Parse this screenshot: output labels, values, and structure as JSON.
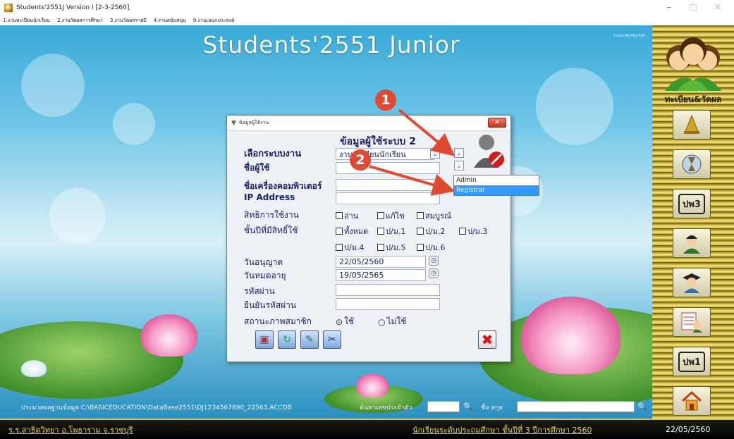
{
  "window": {
    "title": "Students'2551J Version I [2-3-2560]",
    "controls": {
      "minimize": "–",
      "maximize": "□",
      "close": "✕"
    }
  },
  "menu": {
    "items": [
      "1.งานทะเบียนนักเรียน",
      "2.งานวัดผลการศึกษา",
      "3.งานวัดผลรายปี",
      "4.งานสนับสนุน",
      "9.งานเอนกประสงค์"
    ]
  },
  "desktop": {
    "app_title": "Students'2551 Junior",
    "version_tag": "Comp.05/05/2560",
    "status_path": "ประมวลผลฐานข้อมูล C:\\BASICEDUCATION\\DataBase2551\\DJ1234567890_22563.ACCDB",
    "search_id_label": "ค้นหาเลขประจำตัว",
    "search_id_value": "",
    "search_name_label": "ชื่อ  สกุล",
    "search_name_value": ""
  },
  "bottombar": {
    "school": "ร.ร.สาธิตวิทยา  อ.โพธาราม  จ.ราชบุรี",
    "level": "นักเรียนระดับประถมศึกษา  ชั้นปีที่ 3  ปีการศึกษา 2560",
    "date": "22/05/2560"
  },
  "rightpanel": {
    "label": "ทะเบียน&วัดผล",
    "buttons": [
      "bell-icon",
      "hourglass-icon",
      "pw3-icon",
      "student-icon",
      "graduate-icon",
      "grade-sheet-icon",
      "pw1-icon",
      "home-icon"
    ],
    "pw3_text": "ปพ3",
    "pw1_text": "ปพ1"
  },
  "dialog": {
    "title": "ข้อมูลผู้ใช้งาน",
    "heading": "ข้อมูลผู้ใช้ระบบ 2",
    "labels": {
      "work_system": "เลือกระบบงาน",
      "user_name": "ชื่อผู้ใช้",
      "computer_name": "ชื่อเครื่องคอมพิวเตอร์",
      "ip_address": "IP Address",
      "rights": "สิทธิการใช้งาน",
      "grades": "ชั้นปีที่มีสิทธิ์ใช้",
      "permit_date": "วันอนุญาต",
      "expire_date": "วันหมดอายุ",
      "password": "รหัสผ่าน",
      "confirm_password": "ยืนยันรหัสผ่าน",
      "member_status": "สถานะภาพสมาชิก"
    },
    "values": {
      "work_system": "งานทะเบียนนักเรียน",
      "user_name": "",
      "computer_name": "",
      "ip_address": "",
      "permit_date": "22/05/2560",
      "expire_date": "19/05/2565",
      "password": "",
      "confirm_password": ""
    },
    "rights_options": [
      "อ่าน",
      "แก้ไข",
      "สมบูรณ์"
    ],
    "grade_options": [
      "ทั้งหมด",
      "ป/ม.1",
      "ป/ม.2",
      "ป/ม.3",
      "ป/ม.4",
      "ป/ม.5",
      "ป/ม.6"
    ],
    "status_options": [
      "ใช้",
      "ไม่ใช้"
    ],
    "status_selected": "ใช้"
  },
  "dropdown": {
    "items": [
      "Admin",
      "Registrar"
    ],
    "selected": "Registrar"
  },
  "annotations": {
    "step1": "1",
    "step2": "2",
    "color": "#e04a30"
  }
}
